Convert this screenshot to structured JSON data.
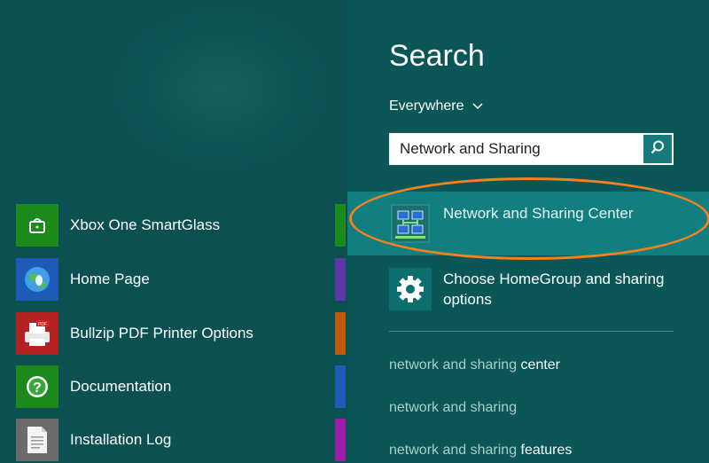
{
  "search": {
    "title": "Search",
    "scope": "Everywhere",
    "query": "Network and Sharing"
  },
  "apps": [
    {
      "label": "Xbox One SmartGlass",
      "icon": "xbox-smartglass-icon",
      "color": "#1b8a1b"
    },
    {
      "label": "Home Page",
      "icon": "globe-icon",
      "color": "#1e5bb8"
    },
    {
      "label": "Bullzip PDF Printer Options",
      "icon": "pdf-printer-icon",
      "color": "#b52020"
    },
    {
      "label": "Documentation",
      "icon": "help-icon",
      "color": "#1b8a1b"
    },
    {
      "label": "Installation Log",
      "icon": "document-icon",
      "color": "#6b6b6b"
    }
  ],
  "results": [
    {
      "label": "Network and Sharing Center",
      "icon": "network-icon"
    },
    {
      "label": "Choose HomeGroup and sharing options",
      "icon": "gear-icon"
    }
  ],
  "suggestions": [
    {
      "query": "network and sharing",
      "suffix": " center"
    },
    {
      "query": "network and sharing",
      "suffix": ""
    },
    {
      "query": "network and sharing",
      "suffix": " features"
    }
  ],
  "colors": {
    "accent": "#f5811f",
    "highlight": "#117e7f",
    "panel": "#0b5656"
  }
}
